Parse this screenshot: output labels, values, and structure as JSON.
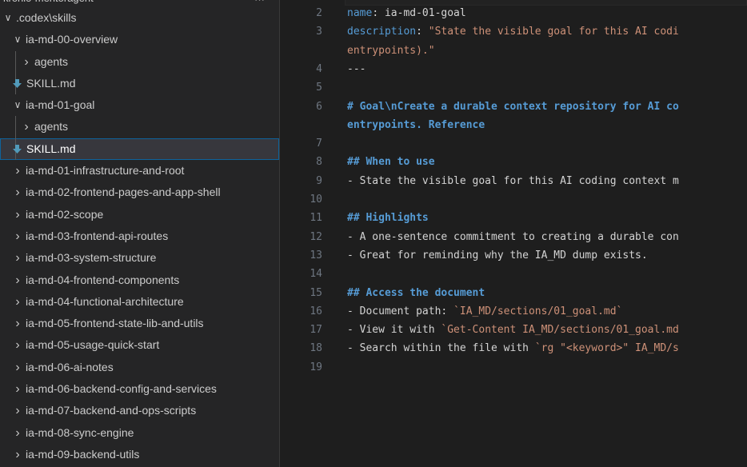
{
  "explorer": {
    "header_partial": "kronio-mentoragent",
    "rows": [
      {
        "depth": 0,
        "chevron": "down",
        "label": ".codex\\skills"
      },
      {
        "depth": 1,
        "chevron": "down",
        "label": "ia-md-00-overview"
      },
      {
        "depth": 2,
        "chevron": "right",
        "label": "agents"
      },
      {
        "depth": 2,
        "chevron": "file",
        "label": "SKILL.md"
      },
      {
        "depth": 1,
        "chevron": "down",
        "label": "ia-md-01-goal"
      },
      {
        "depth": 2,
        "chevron": "right",
        "label": "agents"
      },
      {
        "depth": 2,
        "chevron": "file",
        "label": "SKILL.md",
        "selected": true
      },
      {
        "depth": 1,
        "chevron": "right",
        "label": "ia-md-01-infrastructure-and-root"
      },
      {
        "depth": 1,
        "chevron": "right",
        "label": "ia-md-02-frontend-pages-and-app-shell"
      },
      {
        "depth": 1,
        "chevron": "right",
        "label": "ia-md-02-scope"
      },
      {
        "depth": 1,
        "chevron": "right",
        "label": "ia-md-03-frontend-api-routes"
      },
      {
        "depth": 1,
        "chevron": "right",
        "label": "ia-md-03-system-structure"
      },
      {
        "depth": 1,
        "chevron": "right",
        "label": "ia-md-04-frontend-components"
      },
      {
        "depth": 1,
        "chevron": "right",
        "label": "ia-md-04-functional-architecture"
      },
      {
        "depth": 1,
        "chevron": "right",
        "label": "ia-md-05-frontend-state-lib-and-utils"
      },
      {
        "depth": 1,
        "chevron": "right",
        "label": "ia-md-05-usage-quick-start"
      },
      {
        "depth": 1,
        "chevron": "right",
        "label": "ia-md-06-ai-notes"
      },
      {
        "depth": 1,
        "chevron": "right",
        "label": "ia-md-06-backend-config-and-services"
      },
      {
        "depth": 1,
        "chevron": "right",
        "label": "ia-md-07-backend-and-ops-scripts"
      },
      {
        "depth": 1,
        "chevron": "right",
        "label": "ia-md-08-sync-engine"
      },
      {
        "depth": 1,
        "chevron": "right",
        "label": "ia-md-09-backend-utils"
      }
    ],
    "icons": {
      "chevron_down": "chevron-down-icon",
      "chevron_right": "chevron-right-icon",
      "markdown": "markdown-file-icon"
    },
    "colors": {
      "markdown_icon": "#519aba",
      "selected_border": "#0e639c"
    }
  },
  "editor": {
    "lines": [
      {
        "n": "2",
        "parts": [
          [
            "k",
            "name"
          ],
          [
            "t",
            ": ia-md-01-goal"
          ]
        ]
      },
      {
        "n": "3",
        "parts": [
          [
            "k",
            "description"
          ],
          [
            "t",
            ": "
          ],
          [
            "s",
            "\"State the visible goal for this AI codi"
          ]
        ]
      },
      {
        "n": "",
        "parts": [
          [
            "s",
            "entrypoints).\""
          ]
        ]
      },
      {
        "n": "4",
        "parts": [
          [
            "t",
            "---"
          ]
        ]
      },
      {
        "n": "5",
        "parts": []
      },
      {
        "n": "6",
        "parts": [
          [
            "h",
            "# Goal\\nCreate a durable context repository for AI co"
          ]
        ]
      },
      {
        "n": "",
        "parts": [
          [
            "h",
            "entrypoints. Reference"
          ]
        ]
      },
      {
        "n": "7",
        "parts": []
      },
      {
        "n": "8",
        "parts": [
          [
            "h",
            "## When to use"
          ]
        ]
      },
      {
        "n": "9",
        "parts": [
          [
            "t",
            "- State the visible goal for this AI coding context m"
          ]
        ]
      },
      {
        "n": "10",
        "parts": []
      },
      {
        "n": "11",
        "parts": [
          [
            "h",
            "## Highlights"
          ]
        ]
      },
      {
        "n": "12",
        "parts": [
          [
            "t",
            "- A one-sentence commitment to creating a durable con"
          ]
        ]
      },
      {
        "n": "13",
        "parts": [
          [
            "t",
            "- Great for reminding why the IA_MD dump exists."
          ]
        ]
      },
      {
        "n": "14",
        "parts": []
      },
      {
        "n": "15",
        "parts": [
          [
            "h",
            "## Access the document"
          ]
        ]
      },
      {
        "n": "16",
        "parts": [
          [
            "t",
            "- Document path: "
          ],
          [
            "s",
            "`IA_MD/sections/01_goal.md`"
          ]
        ]
      },
      {
        "n": "17",
        "parts": [
          [
            "t",
            "- View it with "
          ],
          [
            "s",
            "`Get-Content IA_MD/sections/01_goal.md"
          ]
        ]
      },
      {
        "n": "18",
        "parts": [
          [
            "t",
            "- Search within the file with "
          ],
          [
            "s",
            "`rg \"<keyword>\" IA_MD/s"
          ]
        ]
      },
      {
        "n": "19",
        "parts": []
      }
    ]
  }
}
